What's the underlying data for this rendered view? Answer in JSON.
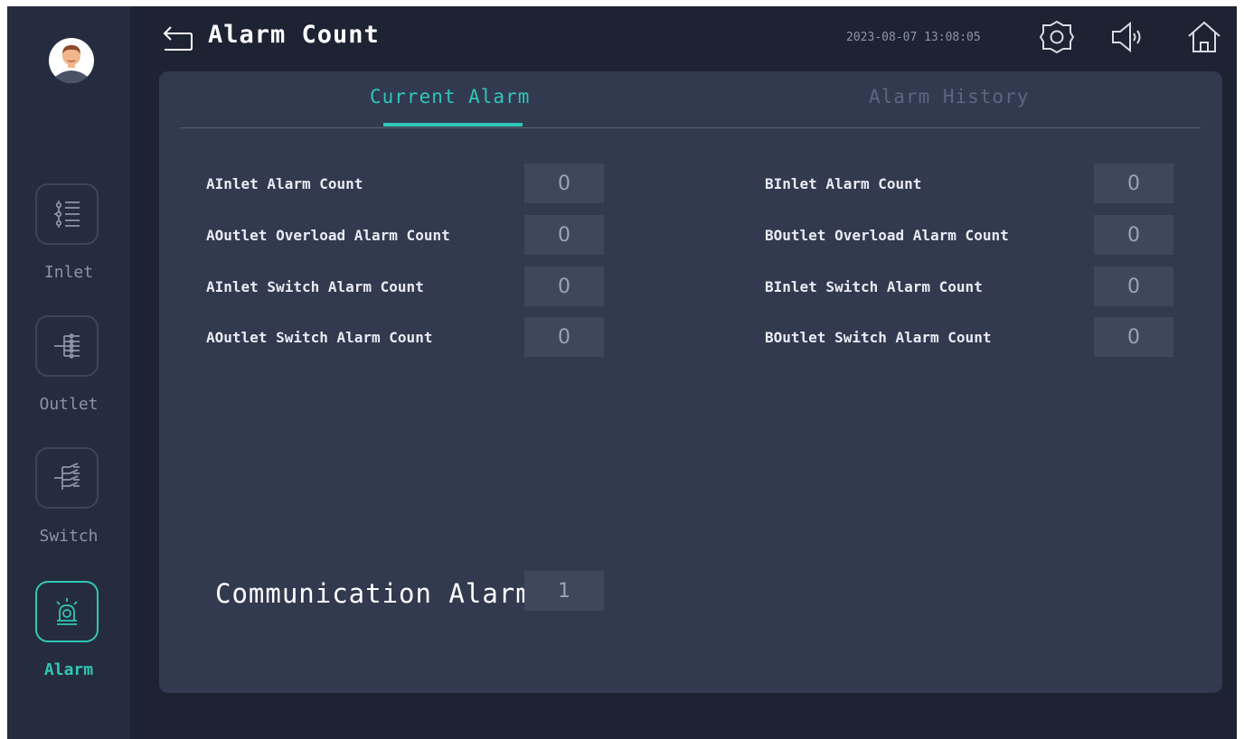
{
  "header": {
    "title": "Alarm Count",
    "datetime": "2023-08-07 13:08:05",
    "icons": [
      "back-icon",
      "gear-icon",
      "speaker-icon",
      "home-icon"
    ]
  },
  "sidebar": {
    "items": [
      {
        "label": "Inlet",
        "icon": "inlet-icon",
        "active": false
      },
      {
        "label": "Outlet",
        "icon": "outlet-icon",
        "active": false
      },
      {
        "label": "Switch",
        "icon": "switch-icon",
        "active": false
      },
      {
        "label": "Alarm",
        "icon": "alarm-icon",
        "active": true
      }
    ]
  },
  "tabs": [
    {
      "label": "Current Alarm",
      "active": true
    },
    {
      "label": "Alarm History",
      "active": false
    }
  ],
  "left_counts": [
    {
      "label": "AInlet Alarm Count",
      "value": "0"
    },
    {
      "label": "AOutlet Overload Alarm Count",
      "value": "0"
    },
    {
      "label": "AInlet Switch Alarm Count",
      "value": "0"
    },
    {
      "label": "AOutlet Switch Alarm Count",
      "value": "0"
    }
  ],
  "right_counts": [
    {
      "label": "BInlet Alarm Count",
      "value": "0"
    },
    {
      "label": "BOutlet Overload Alarm Count",
      "value": "0"
    },
    {
      "label": "BInlet Switch Alarm Count",
      "value": "0"
    },
    {
      "label": "BOutlet Switch Alarm Count",
      "value": "0"
    }
  ],
  "communication": {
    "label": "Communication Alarm",
    "value": "1"
  },
  "colors": {
    "accent": "#2fc7b6",
    "background": "#1e2333",
    "sidebar": "#262c3f",
    "panel": "#323a50",
    "value_box": "#3f475c"
  }
}
